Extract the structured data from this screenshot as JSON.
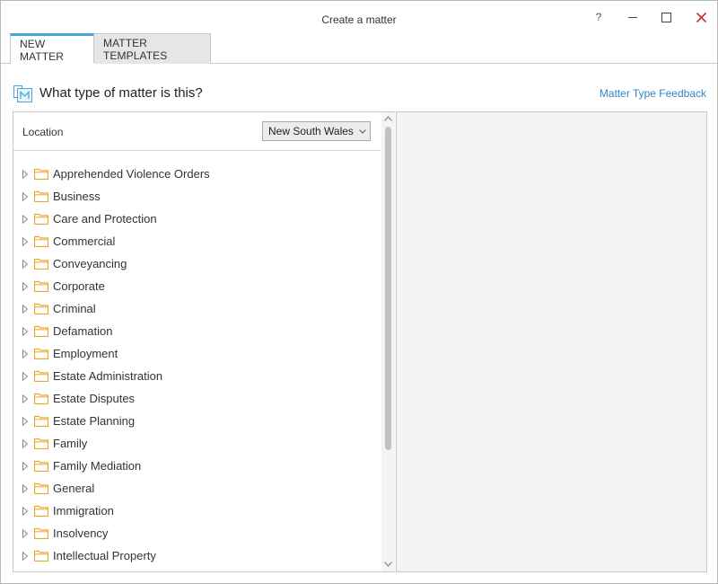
{
  "window": {
    "title": "Create a matter",
    "help_label": "?"
  },
  "tabs": [
    {
      "label": "NEW MATTER",
      "active": true
    },
    {
      "label": "MATTER TEMPLATES",
      "active": false
    }
  ],
  "header": {
    "question": "What type of matter is this?",
    "feedback_link": "Matter Type Feedback"
  },
  "location": {
    "label": "Location",
    "selected": "New South Wales"
  },
  "tree": {
    "items": [
      {
        "label": "Apprehended Violence Orders"
      },
      {
        "label": "Business"
      },
      {
        "label": "Care and Protection"
      },
      {
        "label": "Commercial"
      },
      {
        "label": "Conveyancing"
      },
      {
        "label": "Corporate"
      },
      {
        "label": "Criminal"
      },
      {
        "label": "Defamation"
      },
      {
        "label": "Employment"
      },
      {
        "label": "Estate Administration"
      },
      {
        "label": "Estate Disputes"
      },
      {
        "label": "Estate Planning"
      },
      {
        "label": "Family"
      },
      {
        "label": "Family Mediation"
      },
      {
        "label": "General"
      },
      {
        "label": "Immigration"
      },
      {
        "label": "Insolvency"
      },
      {
        "label": "Intellectual Property"
      }
    ]
  },
  "colors": {
    "accent": "#4aa3e0",
    "link": "#2e86c9",
    "folder": "#e8a82c",
    "close": "#c42b1c"
  }
}
